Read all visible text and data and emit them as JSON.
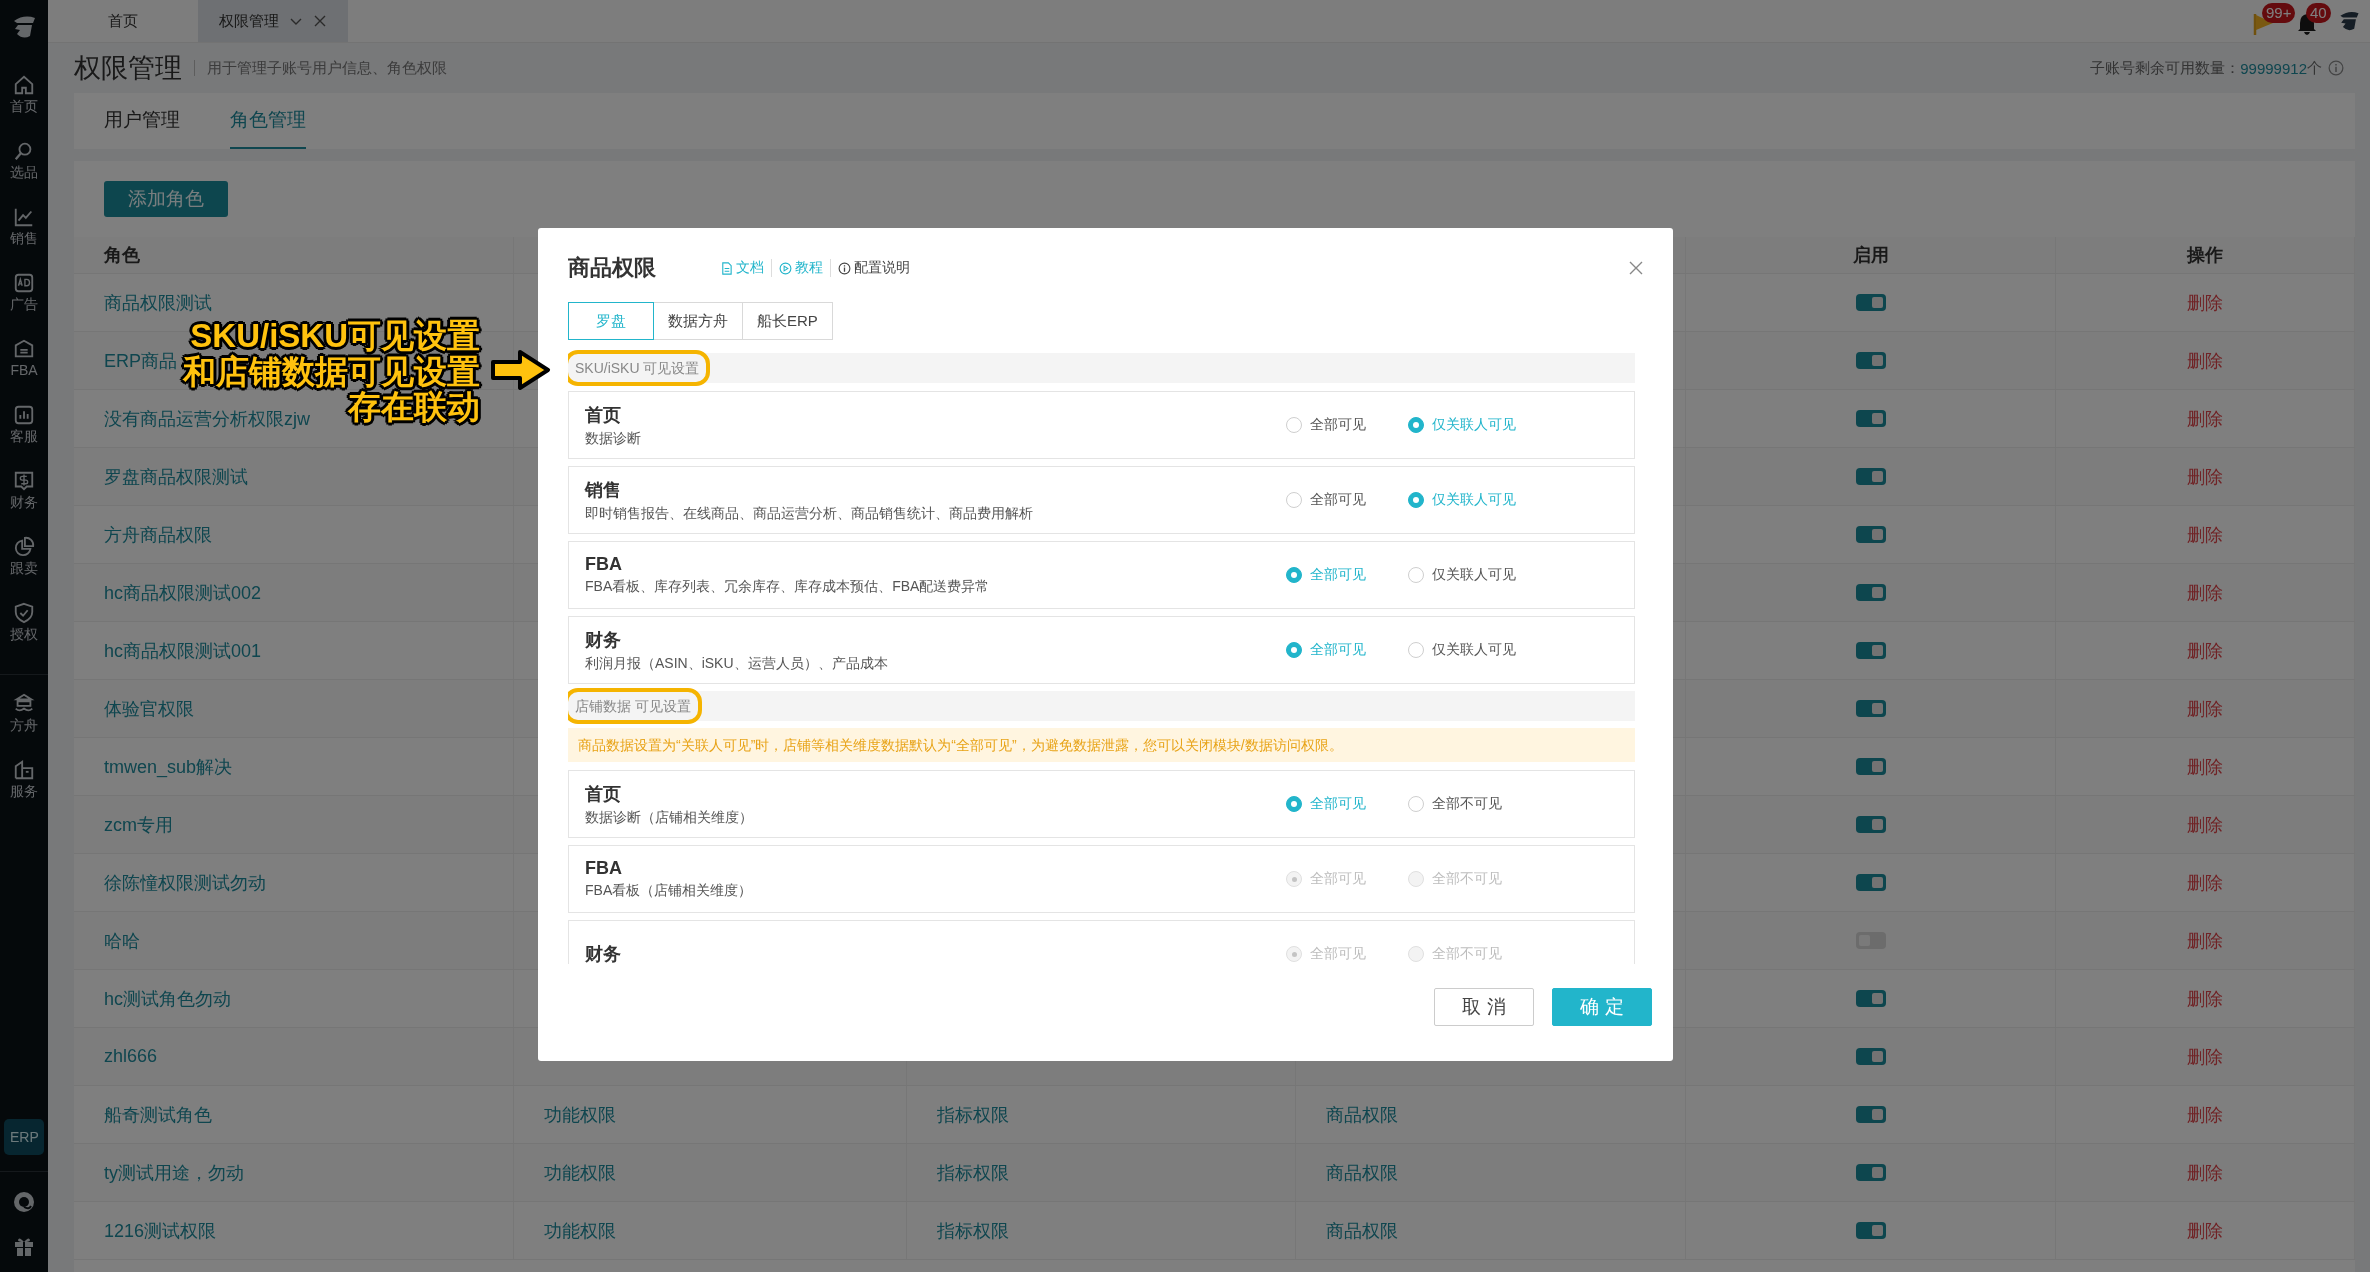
{
  "sidebar": {
    "groups": [
      [
        {
          "label": "首页"
        },
        {
          "label": "选品"
        },
        {
          "label": "销售"
        },
        {
          "label": "广告"
        },
        {
          "label": "FBA"
        },
        {
          "label": "客服"
        },
        {
          "label": "财务"
        },
        {
          "label": "跟卖"
        },
        {
          "label": "授权"
        }
      ],
      [
        {
          "label": "方舟"
        },
        {
          "label": "服务"
        }
      ]
    ],
    "badge": "ERP"
  },
  "top_tabs": [
    {
      "label": "首页",
      "selected": false,
      "closable": false
    },
    {
      "label": "权限管理",
      "selected": true,
      "closable": true
    }
  ],
  "notifications": [
    {
      "kind": "flag",
      "badge": "99+"
    },
    {
      "kind": "bell",
      "badge": "40"
    }
  ],
  "page": {
    "title": "权限管理",
    "subtitle": "用于管理子账号用户信息、角色权限",
    "quota_label": "子账号剩余可用数量：",
    "quota_value": "99999912",
    "quota_unit": "个"
  },
  "page_tabs": [
    {
      "label": "用户管理",
      "selected": false
    },
    {
      "label": "角色管理",
      "selected": true
    }
  ],
  "add_button": "添加角色",
  "table": {
    "headers": {
      "role": "角色",
      "enabled": "启用",
      "actions": "操作"
    },
    "rows": [
      {
        "role": "商品权限测试",
        "enabled": true,
        "action": "删除"
      },
      {
        "role": "ERP商品",
        "enabled": true,
        "action": "删除"
      },
      {
        "role": "没有商品运营分析权限zjw",
        "enabled": true,
        "action": "删除"
      },
      {
        "role": "罗盘商品权限测试",
        "enabled": true,
        "action": "删除"
      },
      {
        "role": "方舟商品权限",
        "enabled": true,
        "action": "删除"
      },
      {
        "role": "hc商品权限测试002",
        "enabled": true,
        "action": "删除"
      },
      {
        "role": "hc商品权限测试001",
        "enabled": true,
        "action": "删除"
      },
      {
        "role": "体验官权限",
        "enabled": true,
        "action": "删除"
      },
      {
        "role": "tmwen_sub解决",
        "enabled": true,
        "action": "删除"
      },
      {
        "role": "zcm专用",
        "enabled": true,
        "action": "删除"
      },
      {
        "role": "徐陈憧权限测试勿动",
        "enabled": true,
        "action": "删除"
      },
      {
        "role": "哈哈",
        "enabled": false,
        "action": "删除"
      },
      {
        "role": "hc测试角色勿动",
        "enabled": true,
        "action": "删除"
      },
      {
        "role": "zhl666",
        "enabled": true,
        "action": "删除"
      },
      {
        "role": "船奇测试角色",
        "column_2": "功能权限",
        "column_3": "指标权限",
        "column_4": "商品权限",
        "enabled": true,
        "action": "删除"
      },
      {
        "role": "ty测试用途，勿动",
        "column_2": "功能权限",
        "column_3": "指标权限",
        "column_4": "商品权限",
        "enabled": true,
        "action": "删除"
      },
      {
        "role": "1216测试权限",
        "column_2": "功能权限",
        "column_3": "指标权限",
        "column_4": "商品权限",
        "enabled": true,
        "action": "删除"
      }
    ]
  },
  "dialog": {
    "title": "商品权限",
    "links": [
      {
        "kind": "doc",
        "label": "文档"
      },
      {
        "kind": "video",
        "label": "教程"
      },
      {
        "kind": "info",
        "label": "配置说明"
      }
    ],
    "tabs": [
      {
        "label": "罗盘",
        "selected": true
      },
      {
        "label": "数据方舟",
        "selected": false
      },
      {
        "label": "船长ERP",
        "selected": false
      }
    ],
    "sections": [
      {
        "title": "SKU/iSKU 可见设置",
        "highlighted": true,
        "modules": [
          {
            "title": "首页",
            "description": "数据诊断",
            "disabled": false,
            "options": [
              {
                "label": "全部可见",
                "selected": false
              },
              {
                "label": "仅关联人可见",
                "selected": true
              }
            ]
          },
          {
            "title": "销售",
            "description": "即时销售报告、在线商品、商品运营分析、商品销售统计、商品费用解析",
            "disabled": false,
            "options": [
              {
                "label": "全部可见",
                "selected": false
              },
              {
                "label": "仅关联人可见",
                "selected": true
              }
            ]
          },
          {
            "title": "FBA",
            "description": "FBA看板、库存列表、冗余库存、库存成本预估、FBA配送费异常",
            "disabled": false,
            "options": [
              {
                "label": "全部可见",
                "selected": true
              },
              {
                "label": "仅关联人可见",
                "selected": false
              }
            ]
          },
          {
            "title": "财务",
            "description": "利润月报（ASIN、iSKU、运营人员）、产品成本",
            "disabled": false,
            "options": [
              {
                "label": "全部可见",
                "selected": true
              },
              {
                "label": "仅关联人可见",
                "selected": false
              }
            ]
          }
        ]
      },
      {
        "title": "店铺数据 可见设置",
        "highlighted": true,
        "notice": "商品数据设置为“关联人可见”时，店铺等相关维度数据默认为“全部可见”，为避免数据泄露，您可以关闭模块/数据访问权限。",
        "modules": [
          {
            "title": "首页",
            "description": "数据诊断（店铺相关维度）",
            "disabled": false,
            "options": [
              {
                "label": "全部可见",
                "selected": true
              },
              {
                "label": "全部不可见",
                "selected": false
              }
            ]
          },
          {
            "title": "FBA",
            "description": "FBA看板（店铺相关维度）",
            "disabled": true,
            "options": [
              {
                "label": "全部可见",
                "selected": true
              },
              {
                "label": "全部不可见",
                "selected": false
              }
            ]
          },
          {
            "title": "财务",
            "disabled": true,
            "options": [
              {
                "label": "全部可见",
                "selected": true
              },
              {
                "label": "全部不可见",
                "selected": false
              }
            ]
          }
        ]
      }
    ],
    "buttons": [
      {
        "kind": "secondary",
        "label": "取消"
      },
      {
        "kind": "primary",
        "label": "确定"
      }
    ]
  },
  "annotation": {
    "lines": [
      "SKU/iSKU可见设置",
      "和店铺数据可见设置",
      "存在联动"
    ]
  }
}
